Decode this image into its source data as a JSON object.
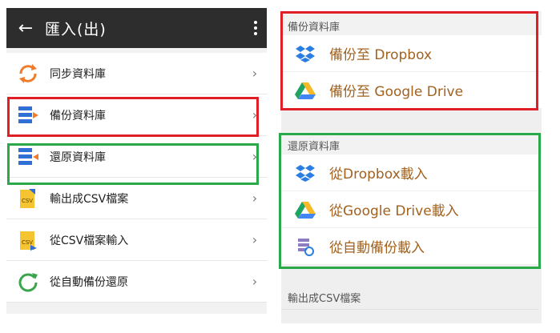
{
  "left": {
    "appbar": {
      "back_icon": "arrow-left-icon",
      "title": "匯入(出)",
      "more_icon": "more-vertical-icon"
    },
    "items": [
      {
        "label": "同步資料庫",
        "icon": "sync-icon"
      },
      {
        "label": "備份資料庫",
        "icon": "backup-icon"
      },
      {
        "label": "還原資料庫",
        "icon": "restore-icon"
      },
      {
        "label": "輸出成CSV檔案",
        "icon": "csv-export-icon"
      },
      {
        "label": "從CSV檔案輸入",
        "icon": "csv-import-icon"
      },
      {
        "label": "從自動備份還原",
        "icon": "auto-restore-icon"
      }
    ],
    "chevron": "›"
  },
  "right": {
    "backup_section": {
      "header": "備份資料庫",
      "items": [
        {
          "label": "備份至 Dropbox",
          "icon": "dropbox-icon"
        },
        {
          "label": "備份至 Google Drive",
          "icon": "google-drive-icon"
        }
      ]
    },
    "restore_section": {
      "header": "還原資料庫",
      "items": [
        {
          "label": "從Dropbox載入",
          "icon": "dropbox-icon"
        },
        {
          "label": "從Google Drive載入",
          "icon": "google-drive-icon"
        },
        {
          "label": "從自動備份載入",
          "icon": "auto-backup-icon"
        }
      ]
    },
    "csv_header": "輸出成CSV檔案"
  },
  "colors": {
    "highlight_red": "#e01e25",
    "highlight_green": "#2aa84a",
    "label_brown": "#a3611e",
    "appbar": "#2d2d2d"
  }
}
